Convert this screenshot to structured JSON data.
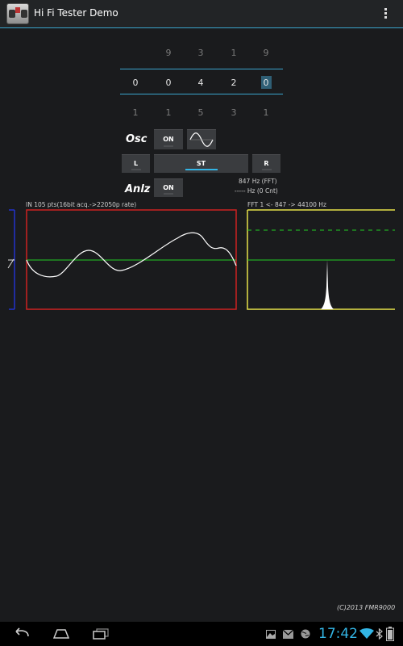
{
  "app": {
    "title": "Hi Fi Tester Demo"
  },
  "picker": {
    "above": [
      "9",
      "3",
      "1",
      "9"
    ],
    "current": [
      "0",
      "0",
      "4",
      "2",
      "0"
    ],
    "below": [
      "1",
      "1",
      "5",
      "3",
      "1"
    ]
  },
  "osc": {
    "label": "Osc",
    "on_button": "ON",
    "waveform_icon": "sine-wave-icon",
    "left_button": "L",
    "stereo_button": "ST",
    "right_button": "R"
  },
  "analyzer": {
    "label": "Anlz",
    "on_button": "ON",
    "fft_freq": "847 Hz (FFT)",
    "cnt_freq": "----- Hz (0 Cnt)"
  },
  "input_panel": {
    "title": "IN 105 pts(16bit acq.->22050p rate)"
  },
  "fft_panel": {
    "title": "FFT  1 <- 847 -> 44100 Hz"
  },
  "footer": {
    "copyright": "(C)2013 FMR9000"
  },
  "status": {
    "time": "17:42"
  },
  "colors": {
    "accent": "#33b5e5",
    "scope_border": "#cc2222",
    "fft_border": "#e6e24a",
    "trace_line": "#22cc22",
    "axis_blue": "#2233cc"
  }
}
